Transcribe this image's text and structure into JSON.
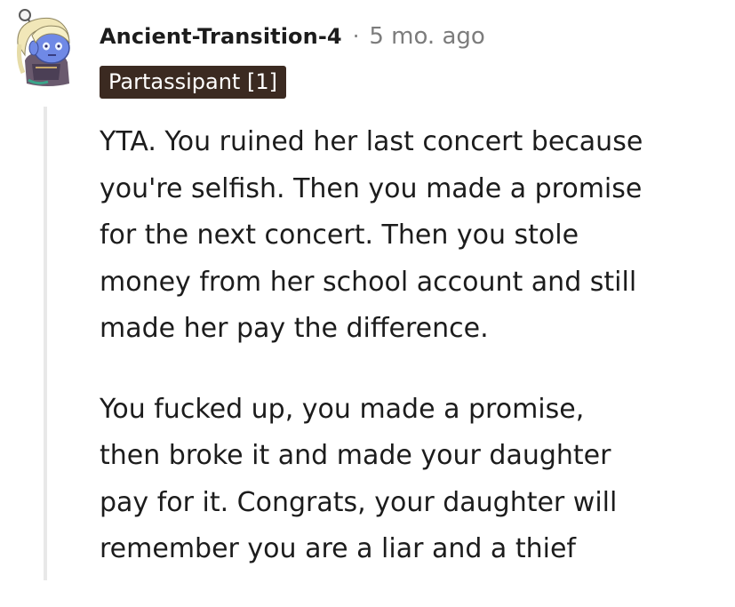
{
  "comment": {
    "author": "Ancient-Transition-4",
    "separator": "·",
    "timestamp": "5 mo. ago",
    "flair": "Partassipant [1]",
    "body": {
      "paragraph1": {
        "line1": "YTA. You ruined her last concert because",
        "line2": "you're selfish. Then you made a promise",
        "line3": "for the next concert. Then you stole",
        "line4": "money from her school account and still",
        "line5": "made her pay the difference."
      },
      "paragraph2": {
        "line1": "You fucked up, you made a promise,",
        "line2": "then broke it and made your daughter",
        "line3": "pay for it. Congrats, your daughter will",
        "line4": "remember you are a liar and a thief"
      }
    }
  },
  "colors": {
    "flair_background": "#3b2a21",
    "muted_text": "#7c7c7c",
    "thread_line": "#e8e8e8",
    "avatar_skin": "#6f89e6"
  }
}
